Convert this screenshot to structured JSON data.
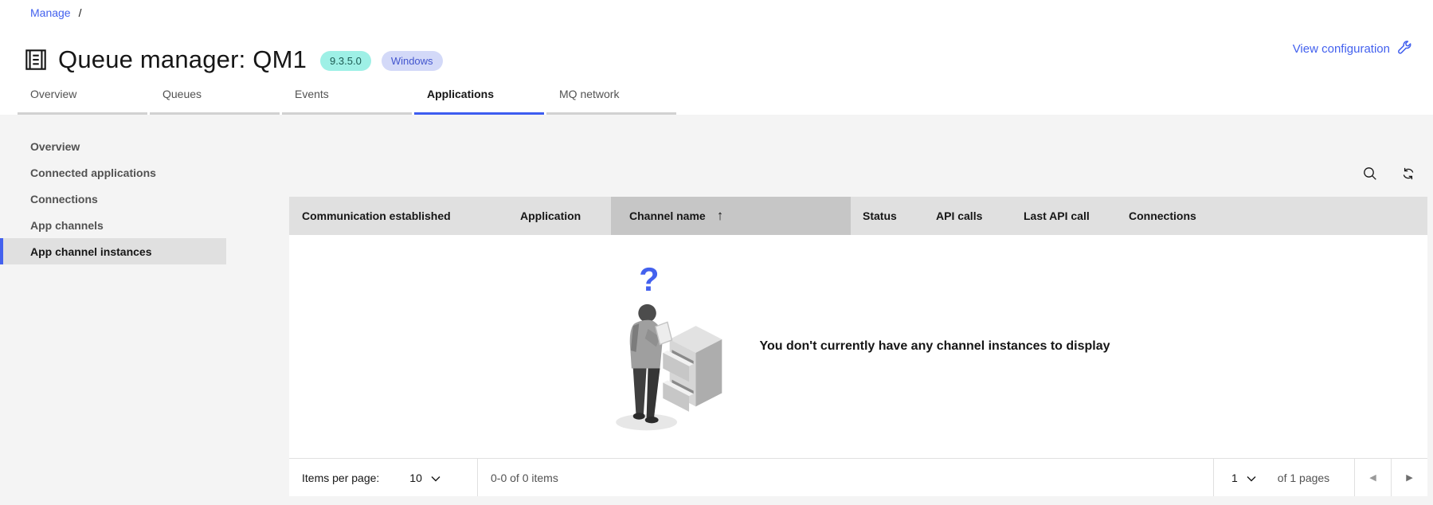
{
  "colors": {
    "accent": "#4361ee",
    "tab_underline": "#3d5cf0",
    "content_bg": "#f4f4f4",
    "table_header_bg": "#e0e0e0",
    "sorted_column_bg": "#c6c6c6",
    "selected_item_bg": "#e0e0e0",
    "version_badge_bg": "#9ef0e6",
    "version_badge_text": "#1c5a52",
    "platform_badge_bg": "#d3d9f8",
    "platform_badge_text": "#4356ce"
  },
  "breadcrumb": {
    "manage_label": "Manage",
    "separator": "/"
  },
  "header": {
    "title": "Queue manager: QM1",
    "version_badge": "9.3.5.0",
    "platform_badge": "Windows",
    "view_configuration_label": "View configuration"
  },
  "tabs": {
    "items": [
      {
        "label": "Overview"
      },
      {
        "label": "Queues"
      },
      {
        "label": "Events"
      },
      {
        "label": "Applications",
        "selected": true
      },
      {
        "label": "MQ network"
      }
    ]
  },
  "sidebar": {
    "items": [
      {
        "label": "Overview"
      },
      {
        "label": "Connected applications"
      },
      {
        "label": "Connections"
      },
      {
        "label": "App channels"
      },
      {
        "label": "App channel instances",
        "selected": true
      }
    ]
  },
  "table": {
    "columns": [
      {
        "label": "Communication established"
      },
      {
        "label": "Application"
      },
      {
        "label": "Channel name",
        "sorted": true,
        "sort_glyph": "↑"
      },
      {
        "label": "Status"
      },
      {
        "label": "API calls"
      },
      {
        "label": "Last API call"
      },
      {
        "label": "Connections"
      }
    ],
    "sort_direction": "ascending",
    "empty_state": {
      "message": "You don't currently have any channel instances to display"
    }
  },
  "pagination": {
    "items_per_page_label": "Items per page:",
    "items_per_page_value": "10",
    "range_text": "0-0 of 0 items",
    "page_value": "1",
    "of_pages_text": "of 1 pages"
  }
}
